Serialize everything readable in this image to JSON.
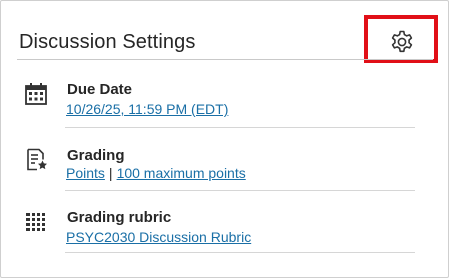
{
  "panel": {
    "title": "Discussion Settings",
    "settings_icon": "gear-icon",
    "highlight_color": "#e10f17",
    "link_color": "#1a6fa6"
  },
  "settings": {
    "due_date": {
      "icon": "calendar-icon",
      "label": "Due Date",
      "value": "10/26/25, 11:59 PM (EDT)"
    },
    "grading": {
      "icon": "grading-star-icon",
      "label": "Grading",
      "value_type": "Points",
      "separator": "|",
      "value_points": "100 maximum points"
    },
    "rubric": {
      "icon": "rubric-grid-icon",
      "label": "Grading rubric",
      "value": "PSYC2030 Discussion Rubric"
    }
  }
}
